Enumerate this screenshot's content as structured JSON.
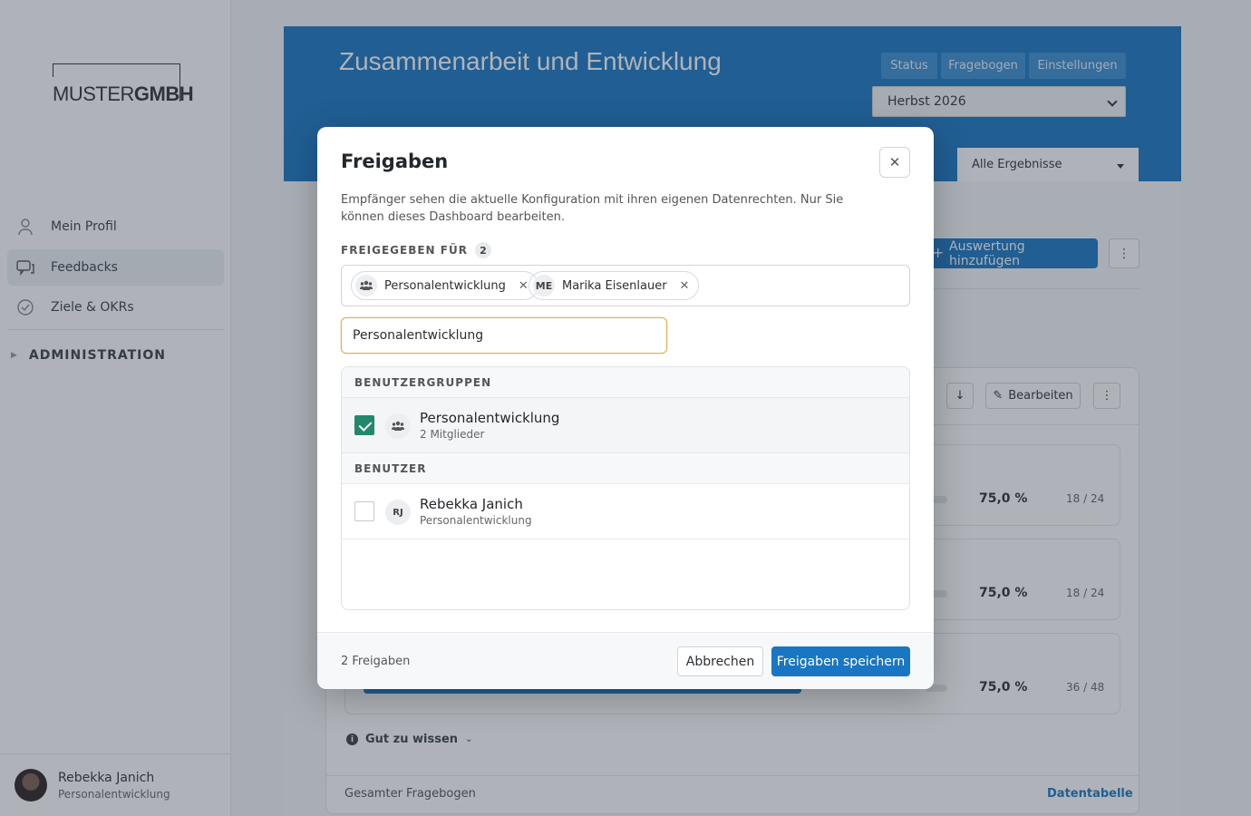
{
  "sidebar": {
    "logo": {
      "light": "MUSTER",
      "bold": "GMBH"
    },
    "items": [
      {
        "label": "Mein Profil",
        "icon": "user-icon"
      },
      {
        "label": "Feedbacks",
        "icon": "chat-icon",
        "active": true
      },
      {
        "label": "Ziele & OKRs",
        "icon": "check-circle-icon"
      }
    ],
    "admin_label": "ADMINISTRATION",
    "user": {
      "name": "Rebekka Janich",
      "role": "Personalentwicklung"
    }
  },
  "header": {
    "title": "Zusammenarbeit und Entwicklung",
    "tabs": [
      "Status",
      "Fragebogen",
      "Einstellungen"
    ],
    "season": "Herbst 2026",
    "results_filter": "Alle Ergebnisse"
  },
  "main": {
    "add_button": "Auswertung hinzufügen",
    "edit_button": "Bearbeiten",
    "rows": [
      {
        "percent": "75,0 %",
        "fraction": "18 / 24"
      },
      {
        "percent": "75,0 %",
        "fraction": "18 / 24"
      },
      {
        "percent": "75,0 %",
        "fraction": "36 / 48"
      }
    ],
    "good_to_know": "Gut zu wissen",
    "footer_left": "Gesamter Fragebogen",
    "footer_right": "Datentabelle"
  },
  "modal": {
    "title": "Freigaben",
    "description": "Empfänger sehen die aktuelle Konfiguration mit ihren eigenen Datenrechten. Nur Sie können dieses Dashboard bearbeiten.",
    "shared_label": "FREIGEGEBEN FÜR",
    "shared_count": "2",
    "chips": [
      {
        "label": "Personalentwicklung",
        "icon": "group-icon"
      },
      {
        "label": "Marika Eisenlauer",
        "initials": "ME"
      }
    ],
    "search_value": "Personalentwicklung",
    "groups_heading": "BENUTZERGRUPPEN",
    "group_result": {
      "name": "Personalentwicklung",
      "sub": "2 Mitglieder",
      "checked": true
    },
    "users_heading": "BENUTZER",
    "user_result": {
      "name": "Rebekka Janich",
      "sub": "Personalentwicklung",
      "initials": "RJ",
      "checked": false
    },
    "footer_count": "2 Freigaben",
    "cancel_label": "Abbrechen",
    "save_label": "Freigaben speichern"
  },
  "colors": {
    "brand": "#1976c2",
    "check": "#23876e"
  }
}
